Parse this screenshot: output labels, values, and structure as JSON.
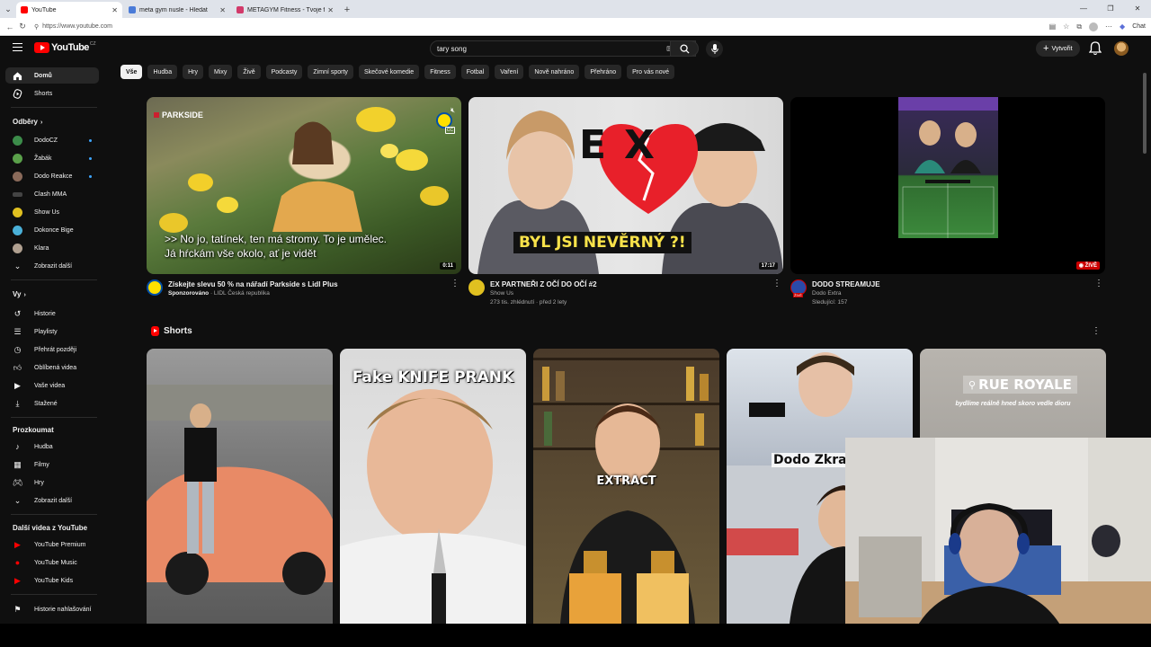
{
  "browser": {
    "tabs": [
      {
        "title": "YouTube",
        "fav_color": "#ff0000",
        "active": true
      },
      {
        "title": "meta gym nusle - Hledat",
        "fav_color": "#4a7bd8",
        "active": false
      },
      {
        "title": "METAGYM Fitness - Tvoje fitko za...",
        "fav_color": "#d23a6a",
        "active": false
      }
    ],
    "url": "https://www.youtube.com",
    "chat_label": "Chat"
  },
  "masthead": {
    "logo_text": "YouTube",
    "logo_country": "CZ",
    "search_value": "tary song",
    "create_label": "Vytvořit"
  },
  "sidebar": {
    "primary": [
      {
        "label": "Domů",
        "icon": "home-icon"
      },
      {
        "label": "Shorts",
        "icon": "shorts-icon"
      }
    ],
    "subscriptions_header": "Odběry",
    "subscriptions": [
      {
        "label": "DodoCZ",
        "color": "#3c8c4a",
        "dot": true
      },
      {
        "label": "Žabák",
        "color": "#5aa04a",
        "dot": true
      },
      {
        "label": "Dodo Reakce",
        "color": "#8a6a5a",
        "dot": true
      },
      {
        "label": "Clash MMA",
        "color": "#444444",
        "dot": false
      },
      {
        "label": "Show Us",
        "color": "#e0c020",
        "dot": false
      },
      {
        "label": "Dokonce Bige",
        "color": "#4ab0d8",
        "dot": false
      },
      {
        "label": "Klara",
        "color": "#b0a090",
        "dot": false
      }
    ],
    "show_more_1": "Zobrazit další",
    "you_header": "Vy",
    "you_items": [
      {
        "label": "Historie",
        "icon": "history-icon"
      },
      {
        "label": "Playlisty",
        "icon": "playlists-icon"
      },
      {
        "label": "Přehrát později",
        "icon": "watch-later-icon"
      },
      {
        "label": "Oblíbená videa",
        "icon": "like-icon"
      },
      {
        "label": "Vaše videa",
        "icon": "your-videos-icon"
      },
      {
        "label": "Stažené",
        "icon": "download-icon"
      }
    ],
    "explore_header": "Prozkoumat",
    "explore_items": [
      {
        "label": "Hudba",
        "icon": "music-icon"
      },
      {
        "label": "Filmy",
        "icon": "film-icon"
      },
      {
        "label": "Hry",
        "icon": "gaming-icon"
      }
    ],
    "show_more_2": "Zobrazit další",
    "more_header": "Další videa z YouTube",
    "more_items": [
      {
        "label": "YouTube Premium",
        "icon": "youtube-premium-icon"
      },
      {
        "label": "YouTube Music",
        "icon": "youtube-music-icon"
      },
      {
        "label": "YouTube Kids",
        "icon": "youtube-kids-icon"
      }
    ],
    "report_history": "Historie nahlašování"
  },
  "chips": [
    "Vše",
    "Hudba",
    "Hry",
    "Mixy",
    "Živě",
    "Podcasty",
    "Zimní sporty",
    "Skečové komedie",
    "Fitness",
    "Fotbal",
    "Vaření",
    "Nově nahráno",
    "Přehráno",
    "Pro vás nové"
  ],
  "videos": [
    {
      "title": "Získejte slevu 50 % na nářadí Parkside s Lidl Plus",
      "sponsored": "Sponzorováno",
      "channel": "LIDL Česká republika",
      "line3": "",
      "duration": "0:11",
      "overlay_brand": "PARKSIDE",
      "overlay_caption": ">> No jo, tatínek, ten má stromy. To je umělec. Já hŕckám vše okolo, ať je vidět",
      "ad_brand": "Lidl"
    },
    {
      "title": "EX PARTNEŘI Z OČÍ DO OČÍ #2",
      "channel": "Show Us",
      "line3": "273 tis. zhlédnutí · před 2 lety",
      "duration": "17:17",
      "overlay_big": "EX",
      "overlay_caption": "BYL JSI NEVĚRNÝ ?!"
    },
    {
      "title": "DODO STREAMUJE",
      "channel": "Dodo Extra",
      "line3": "Sledující: 157",
      "live": "ŽIVĚ",
      "avatar_label": "ŽIVĚ"
    }
  ],
  "shorts": {
    "header": "Shorts",
    "items": [
      {
        "caption": ""
      },
      {
        "caption": "Fake KNIFE PRANK"
      },
      {
        "caption": "EXTRACT"
      },
      {
        "caption": "Dodo Zkracho"
      },
      {
        "caption": "RUE ROYALE",
        "sub": "bydlíme reálně hned skoro vedle dioru"
      }
    ]
  }
}
